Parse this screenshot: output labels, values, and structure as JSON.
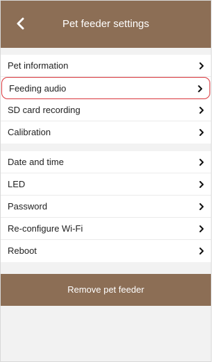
{
  "header": {
    "title": "Pet feeder settings",
    "back_icon": "chevron-left-icon"
  },
  "settings_group_1": [
    {
      "label": "Pet information",
      "chevron_icon": "chevron-right-icon"
    },
    {
      "label": "Feeding audio",
      "chevron_icon": "chevron-right-icon",
      "highlighted": true
    },
    {
      "label": "SD card recording",
      "chevron_icon": "chevron-right-icon"
    },
    {
      "label": "Calibration",
      "chevron_icon": "chevron-right-icon"
    }
  ],
  "settings_group_2": [
    {
      "label": "Date and time",
      "chevron_icon": "chevron-right-icon"
    },
    {
      "label": "LED",
      "chevron_icon": "chevron-right-icon"
    },
    {
      "label": "Password",
      "chevron_icon": "chevron-right-icon"
    },
    {
      "label": "Re-configure Wi-Fi",
      "chevron_icon": "chevron-right-icon"
    },
    {
      "label": "Reboot",
      "chevron_icon": "chevron-right-icon"
    }
  ],
  "remove_button": {
    "label": "Remove pet feeder"
  },
  "colors": {
    "accent_brown": "#8c6e55",
    "highlight_red": "#d9343a",
    "background": "#f2f2f2"
  }
}
